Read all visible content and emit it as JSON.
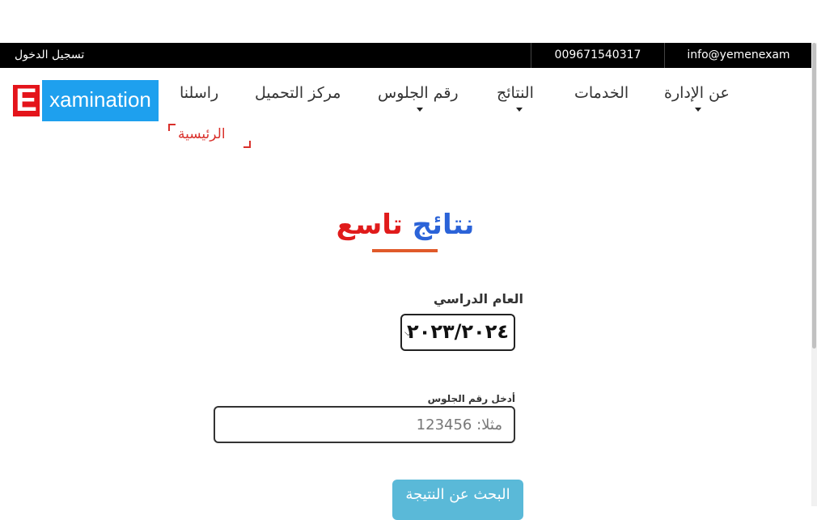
{
  "topbar": {
    "login_label": "تسجيل الدخول",
    "phone": "009671540317",
    "email": "info@yemenexam"
  },
  "logo": {
    "letter": "E",
    "word": "xamination",
    "colors": {
      "letter_bg": "#e4141b",
      "word_bg": "#1ea0ee"
    }
  },
  "nav": {
    "items": [
      {
        "label": "عن الإدارة",
        "has_dropdown": true
      },
      {
        "label": "الخدمات",
        "has_dropdown": false
      },
      {
        "label": "النتائج",
        "has_dropdown": true
      },
      {
        "label": "رقم الجلوس",
        "has_dropdown": true
      },
      {
        "label": "مركز التحميل",
        "has_dropdown": false
      },
      {
        "label": "راسلنا",
        "has_dropdown": false
      }
    ],
    "active_label": "الرئيسية"
  },
  "page": {
    "title_part1": "نتائج",
    "title_part2": "تاسع"
  },
  "form": {
    "year_label": "العام الدراسي",
    "year_value": "٢٠٢٣/٢٠٢٤",
    "seat_label": "أدخل رقم الجلوس",
    "seat_placeholder": "مثلا: 123456",
    "seat_value": "",
    "submit_label": "البحث عن النتيجة"
  }
}
